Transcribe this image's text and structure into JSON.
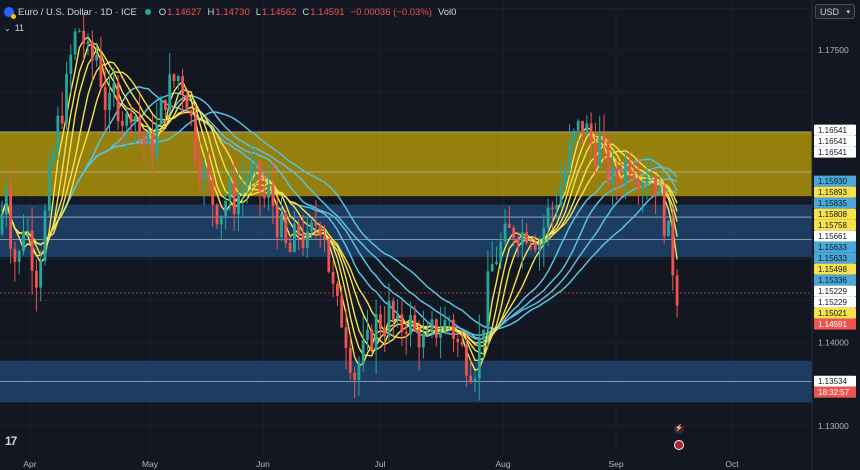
{
  "header": {
    "symbol": "Euro / U.S. Dollar · 1D · ICE",
    "o_label": "O",
    "o": "1.14627",
    "h_label": "H",
    "h": "1.14730",
    "l_label": "L",
    "l": "1.14562",
    "c_label": "C",
    "c": "1.14591",
    "change": "−0.00036 (−0.03%)",
    "vol": "Vol0",
    "indicator_count": "11"
  },
  "currency_button": "USD",
  "colors": {
    "background": "#131722",
    "zone_yellow": "#e6c200",
    "zone_blue": "#2a6bb0",
    "ema_yellow": "#f7e24c",
    "ema_blue": "#5bc0de",
    "up": "#26a69a",
    "down": "#ef5350"
  },
  "chart_data": {
    "type": "candlestick",
    "x_ticks": [
      "Apr",
      "May",
      "Jun",
      "Jul",
      "Aug",
      "Sep",
      "Oct"
    ],
    "y_ticks": [
      1.13,
      1.14,
      1.175
    ],
    "y_tick_labels": [
      "1.13000",
      "1.14000",
      "1.17500"
    ],
    "ylim": [
      1.1265,
      1.181
    ],
    "current_price": 1.14591,
    "countdown": "18:32:57",
    "price_labels": [
      {
        "value": 1.16541,
        "text": "1.16541",
        "style": "white"
      },
      {
        "value": 1.16541,
        "text": "1.16541",
        "style": "white"
      },
      {
        "value": 1.16541,
        "text": "1.16541",
        "style": "white"
      },
      {
        "value": 1.1593,
        "text": "1.15930",
        "style": "blue"
      },
      {
        "value": 1.15893,
        "text": "1.15893",
        "style": "yellow"
      },
      {
        "value": 1.15835,
        "text": "1.15835",
        "style": "blue"
      },
      {
        "value": 1.15808,
        "text": "1.15808",
        "style": "yellow"
      },
      {
        "value": 1.15758,
        "text": "1.15758",
        "style": "yellow"
      },
      {
        "value": 1.15661,
        "text": "1.15661",
        "style": "white"
      },
      {
        "value": 1.15633,
        "text": "1.15633",
        "style": "blue"
      },
      {
        "value": 1.15633,
        "text": "1.15633",
        "style": "blue"
      },
      {
        "value": 1.15498,
        "text": "1.15498",
        "style": "yellow"
      },
      {
        "value": 1.15336,
        "text": "1.15336",
        "style": "blue"
      },
      {
        "value": 1.15229,
        "text": "1.15229",
        "style": "white"
      },
      {
        "value": 1.15229,
        "text": "1.15229",
        "style": "white"
      },
      {
        "value": 1.15021,
        "text": "1.15021",
        "style": "yellow"
      },
      {
        "value": 1.14591,
        "text": "1.14591",
        "style": "red"
      },
      {
        "value": 1.13534,
        "text": "1.13534",
        "style": "white"
      }
    ],
    "zones": [
      {
        "from": 1.1575,
        "to": 1.1652,
        "color": "yellow"
      },
      {
        "from": 1.1502,
        "to": 1.1565,
        "color": "blue"
      },
      {
        "from": 1.1328,
        "to": 1.1378,
        "color": "blue"
      }
    ],
    "lines": [
      1.1652,
      1.1604,
      1.155,
      1.1523,
      1.1353
    ],
    "price_path": [
      [
        0,
        1.153
      ],
      [
        6,
        1.16
      ],
      [
        12,
        1.151
      ],
      [
        18,
        1.149
      ],
      [
        24,
        1.155
      ],
      [
        30,
        1.152
      ],
      [
        36,
        1.148
      ],
      [
        42,
        1.152
      ],
      [
        50,
        1.16
      ],
      [
        58,
        1.166
      ],
      [
        66,
        1.17
      ],
      [
        72,
        1.175
      ],
      [
        78,
        1.178
      ],
      [
        84,
        1.176
      ],
      [
        90,
        1.173
      ],
      [
        96,
        1.175
      ],
      [
        102,
        1.171
      ],
      [
        108,
        1.167
      ],
      [
        114,
        1.17
      ],
      [
        120,
        1.168
      ],
      [
        126,
        1.166
      ],
      [
        132,
        1.169
      ],
      [
        138,
        1.166
      ],
      [
        146,
        1.163
      ],
      [
        154,
        1.164
      ],
      [
        160,
        1.167
      ],
      [
        166,
        1.17
      ],
      [
        172,
        1.171
      ],
      [
        178,
        1.172
      ],
      [
        186,
        1.17
      ],
      [
        192,
        1.166
      ],
      [
        198,
        1.162
      ],
      [
        204,
        1.16
      ],
      [
        210,
        1.158
      ],
      [
        216,
        1.156
      ],
      [
        222,
        1.156
      ],
      [
        228,
        1.158
      ],
      [
        234,
        1.157
      ],
      [
        240,
        1.158
      ],
      [
        246,
        1.16
      ],
      [
        252,
        1.16
      ],
      [
        258,
        1.159
      ],
      [
        264,
        1.157
      ],
      [
        270,
        1.158
      ],
      [
        276,
        1.155
      ],
      [
        282,
        1.153
      ],
      [
        288,
        1.15
      ],
      [
        294,
        1.152
      ],
      [
        300,
        1.154
      ],
      [
        306,
        1.151
      ],
      [
        312,
        1.153
      ],
      [
        318,
        1.155
      ],
      [
        324,
        1.154
      ],
      [
        330,
        1.148
      ],
      [
        336,
        1.144
      ],
      [
        342,
        1.143
      ],
      [
        348,
        1.14
      ],
      [
        354,
        1.136
      ],
      [
        360,
        1.138
      ],
      [
        366,
        1.139
      ],
      [
        372,
        1.141
      ],
      [
        378,
        1.143
      ],
      [
        384,
        1.142
      ],
      [
        390,
        1.144
      ],
      [
        396,
        1.141
      ],
      [
        402,
        1.142
      ],
      [
        408,
        1.143
      ],
      [
        414,
        1.141
      ],
      [
        420,
        1.141
      ],
      [
        426,
        1.139
      ],
      [
        432,
        1.141
      ],
      [
        438,
        1.142
      ],
      [
        444,
        1.142
      ],
      [
        450,
        1.143
      ],
      [
        456,
        1.14
      ],
      [
        462,
        1.139
      ],
      [
        468,
        1.138
      ],
      [
        474,
        1.137
      ],
      [
        480,
        1.14
      ],
      [
        486,
        1.145
      ],
      [
        492,
        1.149
      ],
      [
        498,
        1.151
      ],
      [
        504,
        1.152
      ],
      [
        510,
        1.153
      ],
      [
        516,
        1.154
      ],
      [
        522,
        1.153
      ],
      [
        528,
        1.154
      ],
      [
        534,
        1.153
      ],
      [
        540,
        1.152
      ],
      [
        546,
        1.155
      ],
      [
        552,
        1.156
      ],
      [
        558,
        1.158
      ],
      [
        564,
        1.16
      ],
      [
        570,
        1.163
      ],
      [
        576,
        1.165
      ],
      [
        582,
        1.166
      ],
      [
        588,
        1.165
      ],
      [
        594,
        1.163
      ],
      [
        600,
        1.164
      ],
      [
        606,
        1.161
      ],
      [
        612,
        1.159
      ],
      [
        618,
        1.16
      ],
      [
        624,
        1.161
      ],
      [
        630,
        1.162
      ],
      [
        636,
        1.161
      ],
      [
        642,
        1.16
      ],
      [
        648,
        1.161
      ],
      [
        654,
        1.16
      ],
      [
        660,
        1.157
      ],
      [
        666,
        1.154
      ],
      [
        672,
        1.15
      ],
      [
        676,
        1.1462
      ],
      [
        680,
        1.1459
      ]
    ]
  }
}
